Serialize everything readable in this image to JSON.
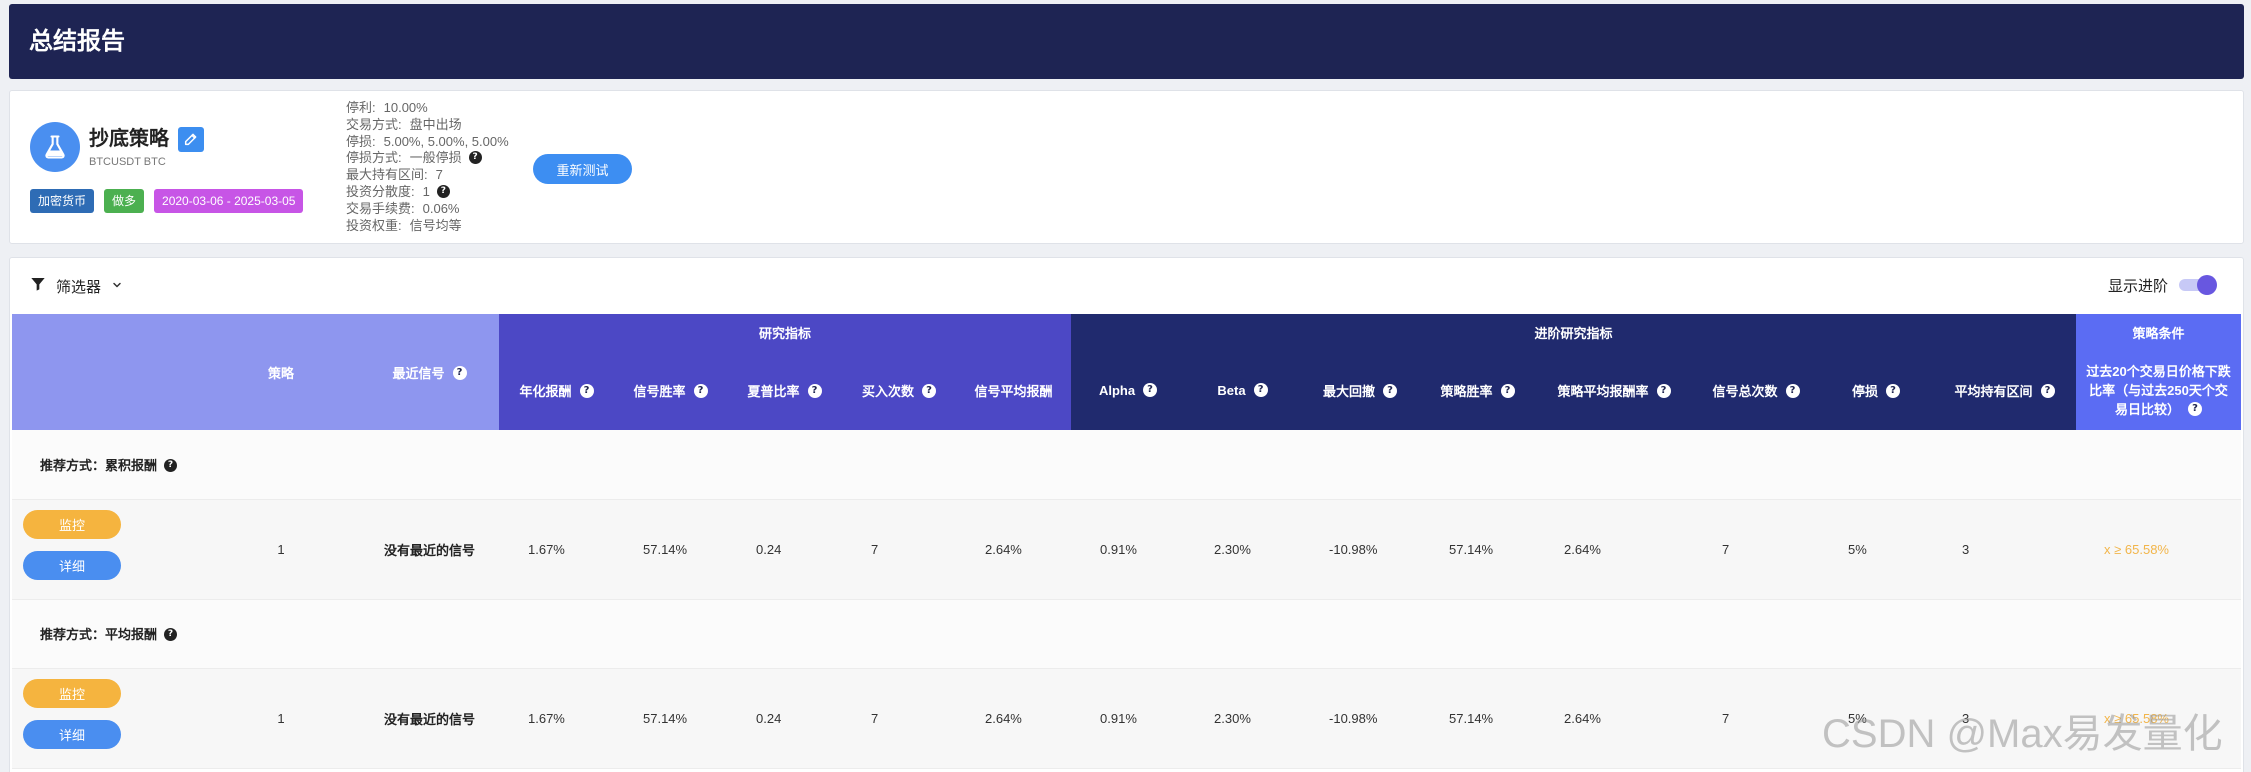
{
  "header": {
    "title": "总结报告"
  },
  "strategy": {
    "icon": "flask-icon",
    "name": "抄底策略",
    "symbol": "BTCUSDT BTC",
    "badges": {
      "market": {
        "label": "加密货币",
        "color": "#2e6cb5"
      },
      "direction": {
        "label": "做多",
        "color": "#4cb050"
      },
      "period": {
        "label": "2020-03-06 - 2025-03-05",
        "color": "#c755e6"
      }
    },
    "params": [
      {
        "label": "停利:",
        "value": "10.00%",
        "help": false
      },
      {
        "label": "交易方式:",
        "value": "盘中出场",
        "help": false
      },
      {
        "label": "停损:",
        "value": "5.00%, 5.00%, 5.00%",
        "help": false
      },
      {
        "label": "停损方式:",
        "value": "一般停损",
        "help": true
      },
      {
        "label": "最大持有区间:",
        "value": "7",
        "help": false
      },
      {
        "label": "投资分散度:",
        "value": "1",
        "help": true
      },
      {
        "label": "交易手续费:",
        "value": "0.06%",
        "help": false
      },
      {
        "label": "投资权重:",
        "value": "信号均等",
        "help": false
      }
    ],
    "retest_label": "重新测试",
    "accent_color": "#3d8ef2"
  },
  "toolbar": {
    "filter_label": "筛选器",
    "advanced_label": "显示进阶",
    "advanced_enabled": true
  },
  "table": {
    "groups": {
      "base": {
        "color": "#8e96ef"
      },
      "research": {
        "label": "研究指标",
        "color": "#4c48c5"
      },
      "advanced": {
        "label": "进阶研究指标",
        "color": "#202a6e"
      },
      "condition": {
        "label": "策略条件",
        "color": "#5b6cf3"
      }
    },
    "columns": {
      "strategy": "策略",
      "recent_signal": "最近信号",
      "annual_return": "年化报酬",
      "signal_win_rate": "信号胜率",
      "sharpe": "夏普比率",
      "buy_count": "买入次数",
      "signal_avg_return": "信号平均报酬",
      "alpha": "Alpha",
      "beta": "Beta",
      "max_drawdown": "最大回撤",
      "strategy_win_rate": "策略胜率",
      "strategy_avg_return": "策略平均报酬率",
      "signal_total": "信号总次数",
      "stop_loss": "停损",
      "avg_holding": "平均持有区间",
      "condition": "过去20个交易日价格下跌比率（与过去250天个交易日比较）"
    },
    "sections": [
      {
        "title": "推荐方式：累积报酬",
        "row": {
          "strategy": "1",
          "recent_signal": "没有最近的信号",
          "annual_return": "1.67%",
          "signal_win_rate": "57.14%",
          "sharpe": "0.24",
          "buy_count": "7",
          "signal_avg_return": "2.64%",
          "alpha": "0.91%",
          "beta": "2.30%",
          "max_drawdown": "-10.98%",
          "strategy_win_rate": "57.14%",
          "strategy_avg_return": "2.64%",
          "signal_total": "7",
          "stop_loss": "5%",
          "avg_holding": "3",
          "condition": "x ≥ 65.58%"
        }
      },
      {
        "title": "推荐方式：平均报酬",
        "row": {
          "strategy": "1",
          "recent_signal": "没有最近的信号",
          "annual_return": "1.67%",
          "signal_win_rate": "57.14%",
          "sharpe": "0.24",
          "buy_count": "7",
          "signal_avg_return": "2.64%",
          "alpha": "0.91%",
          "beta": "2.30%",
          "max_drawdown": "-10.98%",
          "strategy_win_rate": "57.14%",
          "strategy_avg_return": "2.64%",
          "signal_total": "7",
          "stop_loss": "5%",
          "avg_holding": "3",
          "condition": "x ≥ 65.58%"
        }
      }
    ]
  },
  "actions": {
    "monitor_label": "监控",
    "monitor_color": "#f5b43f",
    "detail_label": "详细",
    "detail_color": "#4a8ef0"
  },
  "watermark": "CSDN @Max易发量化"
}
